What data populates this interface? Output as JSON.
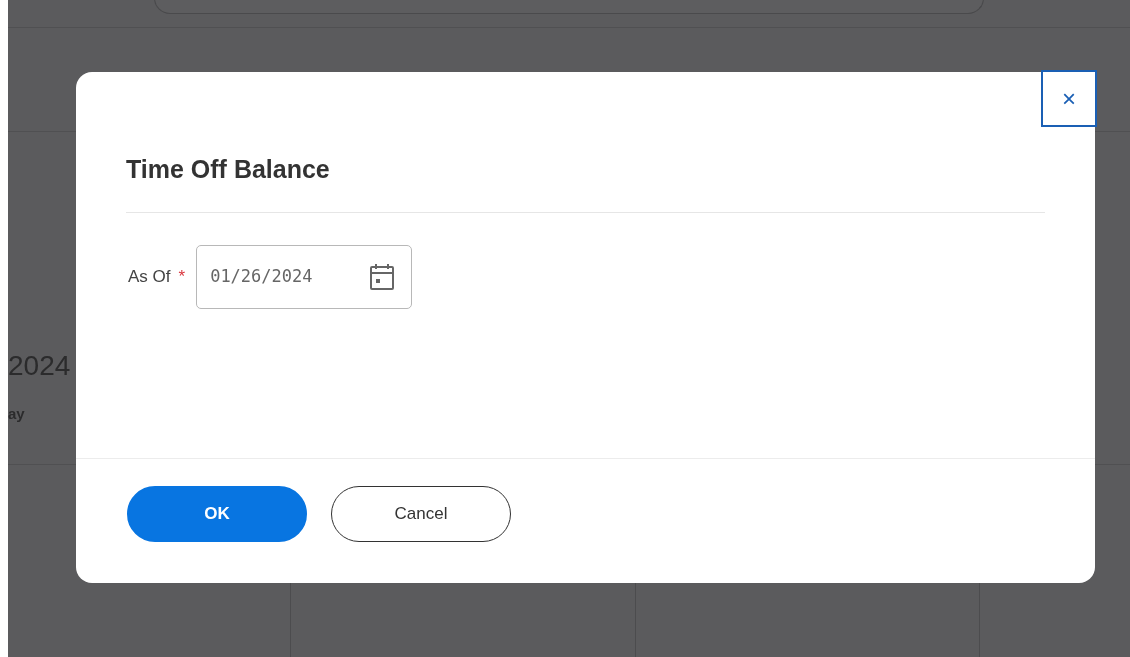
{
  "background": {
    "texts": [
      "2024",
      "ay"
    ]
  },
  "dialog": {
    "title": "Time Off Balance",
    "close": {
      "label": "×",
      "focused": true
    },
    "fields": [
      {
        "label": "As Of",
        "required": true,
        "required_mark": "*",
        "value": "01/26/2024"
      }
    ],
    "buttons": [
      {
        "label": "OK",
        "kind": "primary"
      },
      {
        "label": "Cancel",
        "kind": "secondary"
      }
    ]
  }
}
